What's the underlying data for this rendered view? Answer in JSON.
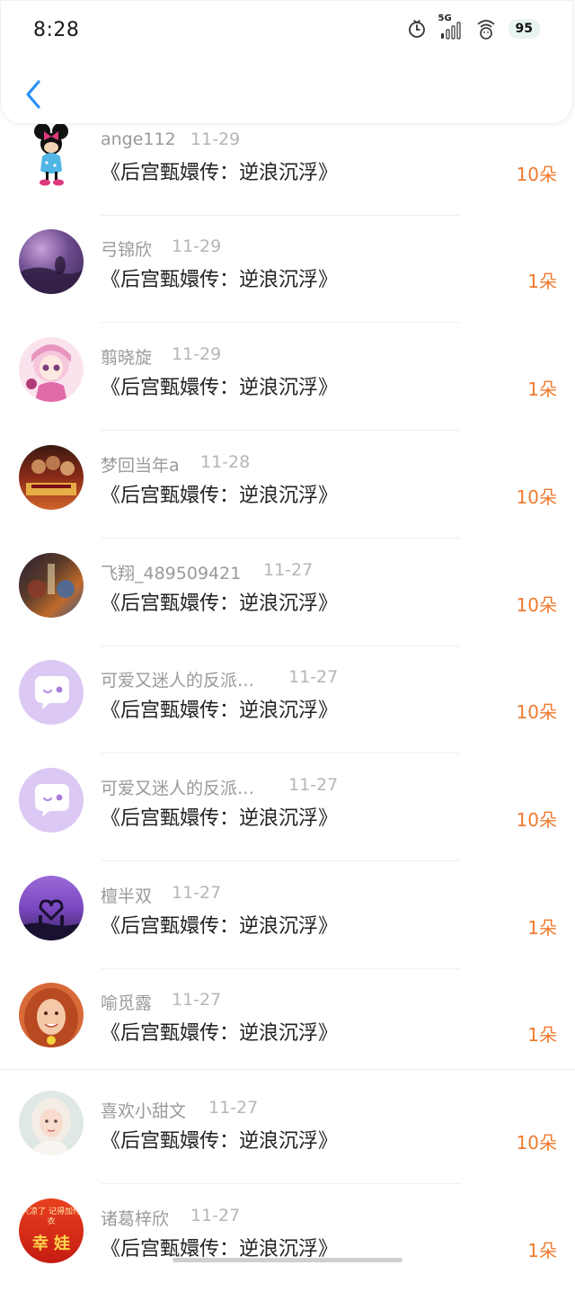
{
  "status_bar": {
    "time": "8:28",
    "network": "5G",
    "battery": "95",
    "icons": [
      "alarm-icon",
      "signal-icon",
      "wifi-icon",
      "battery-icon"
    ]
  },
  "header": {
    "back_icon": "chevron-left-icon",
    "accent_color": "#2a8ff7"
  },
  "colors": {
    "count": "#f07a2e",
    "name": "#9a9a9a",
    "date": "#b6b6b6",
    "title": "#222222"
  },
  "rows": [
    {
      "name": "ange112",
      "date": "11-29",
      "title": "《后宫甄嬛传：逆浪沉浮》",
      "count": "10朵",
      "avatar": "minnie-mouse-avatar"
    },
    {
      "name": "弓锦欣",
      "date": "11-29",
      "title": "《后宫甄嬛传：逆浪沉浮》",
      "count": "1朵",
      "avatar": "purple-landscape-avatar"
    },
    {
      "name": "翦晓旋",
      "date": "11-29",
      "title": "《后宫甄嬛传：逆浪沉浮》",
      "count": "1朵",
      "avatar": "anime-girl-avatar"
    },
    {
      "name": "梦回当年a",
      "date": "11-28",
      "title": "《后宫甄嬛传：逆浪沉浮》",
      "count": "10朵",
      "avatar": "movie-poster-avatar"
    },
    {
      "name": "飞翔_489509421",
      "date": "11-27",
      "title": "《后宫甄嬛传：逆浪沉浮》",
      "count": "10朵",
      "avatar": "fantasy-poster-avatar"
    },
    {
      "name": "可爱又迷人的反派…",
      "date": "11-27",
      "title": "《后宫甄嬛传：逆浪沉浮》",
      "count": "10朵",
      "avatar": "default-chat-avatar"
    },
    {
      "name": "可爱又迷人的反派…",
      "date": "11-27",
      "title": "《后宫甄嬛传：逆浪沉浮》",
      "count": "10朵",
      "avatar": "default-chat-avatar"
    },
    {
      "name": "檀半双",
      "date": "11-27",
      "title": "《后宫甄嬛传：逆浪沉浮》",
      "count": "1朵",
      "avatar": "heart-hands-avatar"
    },
    {
      "name": "喻觅露",
      "date": "11-27",
      "title": "《后宫甄嬛传：逆浪沉浮》",
      "count": "1朵",
      "avatar": "red-hair-woman-avatar"
    },
    {
      "name": "喜欢小甜文",
      "date": "11-27",
      "title": "《后宫甄嬛传：逆浪沉浮》",
      "count": "10朵",
      "avatar": "illustrated-girl-avatar"
    },
    {
      "name": "诸葛梓欣",
      "date": "11-27",
      "title": "《后宫甄嬛传：逆浪沉浮》",
      "count": "1朵",
      "avatar": "red-card-avatar",
      "avatar_text_1": "天凉了",
      "avatar_text_2": "记得加件衣",
      "avatar_text_3": "幸 娃"
    }
  ]
}
